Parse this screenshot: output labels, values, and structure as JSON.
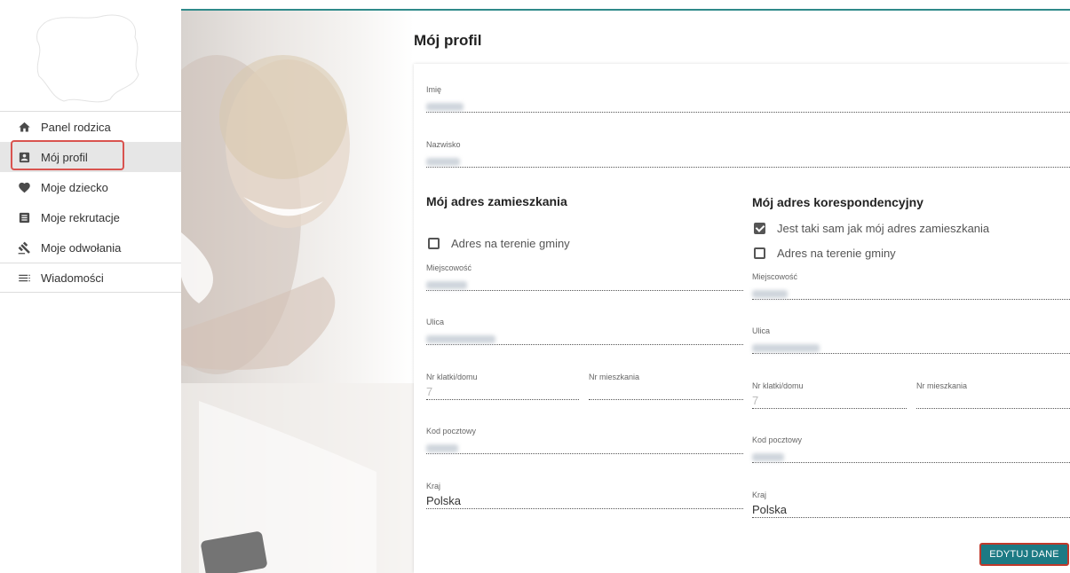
{
  "sidebar": {
    "items": [
      {
        "label": "Panel rodzica",
        "icon": "home-icon"
      },
      {
        "label": "Mój profil",
        "icon": "profile-card-icon"
      },
      {
        "label": "Moje dziecko",
        "icon": "heart-icon"
      },
      {
        "label": "Moje rekrutacje",
        "icon": "list-icon"
      },
      {
        "label": "Moje odwołania",
        "icon": "gavel-icon"
      },
      {
        "label": "Wiadomości",
        "icon": "messages-icon"
      }
    ],
    "active_index": 1
  },
  "page": {
    "title": "Mój profil"
  },
  "profile": {
    "first_name_label": "Imię",
    "last_name_label": "Nazwisko"
  },
  "home_address": {
    "title": "Mój adres zamieszkania",
    "in_municipality_label": "Adres na terenie gminy",
    "in_municipality_checked": false,
    "city_label": "Miejscowość",
    "street_label": "Ulica",
    "building_label": "Nr klatki/domu",
    "building_value": "7",
    "apartment_label": "Nr mieszkania",
    "postal_label": "Kod pocztowy",
    "country_label": "Kraj",
    "country_value": "Polska"
  },
  "correspondence_address": {
    "title": "Mój adres korespondencyjny",
    "same_as_home_label": "Jest taki sam jak mój adres zamieszkania",
    "same_as_home_checked": true,
    "in_municipality_label": "Adres na terenie gminy",
    "in_municipality_checked": false,
    "city_label": "Miejscowość",
    "street_label": "Ulica",
    "building_label": "Nr klatki/domu",
    "building_value": "7",
    "apartment_label": "Nr mieszkania",
    "postal_label": "Kod pocztowy",
    "country_label": "Kraj",
    "country_value": "Polska"
  },
  "actions": {
    "edit_label": "EDYTUJ DANE"
  },
  "colors": {
    "accent": "#1d7a84",
    "highlight": "#d9534f",
    "top_line": "#2f8a8a"
  }
}
